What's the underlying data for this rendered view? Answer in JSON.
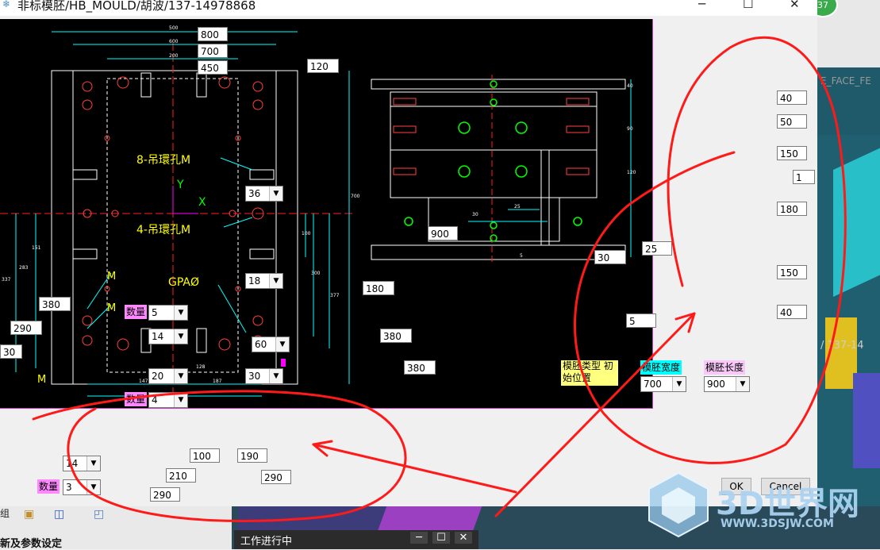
{
  "window": {
    "title": "非标模胚/HB_MOULD/胡波/137-14978868",
    "minimize_icon": "─",
    "maximize_icon": "☐",
    "close_icon": "✕",
    "badge": "37"
  },
  "drawing": {
    "annotations": {
      "lift8": "8-吊環孔M",
      "lift4": "4-吊環孔M",
      "gpa": "GPAØ",
      "axis_y": "Y",
      "axis_x": "X",
      "m1": "M",
      "m2": "M",
      "m3": "M"
    },
    "dims": {
      "d500": "500",
      "d600": "600",
      "d200": "200",
      "d700": "700",
      "d151": "151",
      "d283": "283",
      "d337": "337",
      "d100": "100",
      "d300": "300",
      "d377": "377",
      "d128": "128",
      "d187": "187",
      "d147": "147",
      "d40": "40",
      "d90": "90",
      "d120": "120",
      "d25": "25",
      "d30": "30",
      "d5": "5"
    }
  },
  "fields": {
    "width_800": "800",
    "width_700": "700",
    "width_450": "450",
    "top_120": "120",
    "hole_36": "36",
    "hole_18": "18",
    "hole_60": "60",
    "hole_30": "30",
    "left_380": "380",
    "left_290": "290",
    "left_30": "30",
    "qty_label_1": "数量",
    "qty_5": "5",
    "v14": "14",
    "v20": "20",
    "qty_label_2": "数量",
    "v4": "4",
    "mid_180": "180",
    "mid_380a": "380",
    "mid_380b": "380",
    "side_900": "900",
    "side_30": "30",
    "side_25": "25",
    "side_5": "5",
    "r40": "40",
    "r50": "50",
    "r150a": "150",
    "r1": "1",
    "r180": "180",
    "r150b": "150",
    "r40b": "40",
    "bottom_14": "14",
    "qty_label_3": "数量",
    "bottom_3": "3",
    "b100": "100",
    "b190": "190",
    "b210": "210",
    "b290a": "290",
    "b290b": "290",
    "type_label": "模胚类型 初始位置",
    "width_label": "模胚宽度",
    "width_value": "700",
    "length_label": "模胚长度",
    "length_value": "900"
  },
  "buttons": {
    "ok": "OK",
    "cancel": "Cancel"
  },
  "background": {
    "right_text_1": "E_FACE_FE",
    "right_text_2": "/ 137-14",
    "bottom_left_1": "组",
    "bottom_left_2": "新及参数设定",
    "taskbar_window": "工作进行中",
    "watermark_title": "3D世界网",
    "watermark_url": "WWW.3DSJW.COM"
  },
  "colors": {
    "annotation_red": "#ff1a1a",
    "label_pink": "#ff88ff",
    "label_yellow": "#ffff80",
    "label_cyan": "#00ffff",
    "label_lavender": "#f8c8f8"
  }
}
